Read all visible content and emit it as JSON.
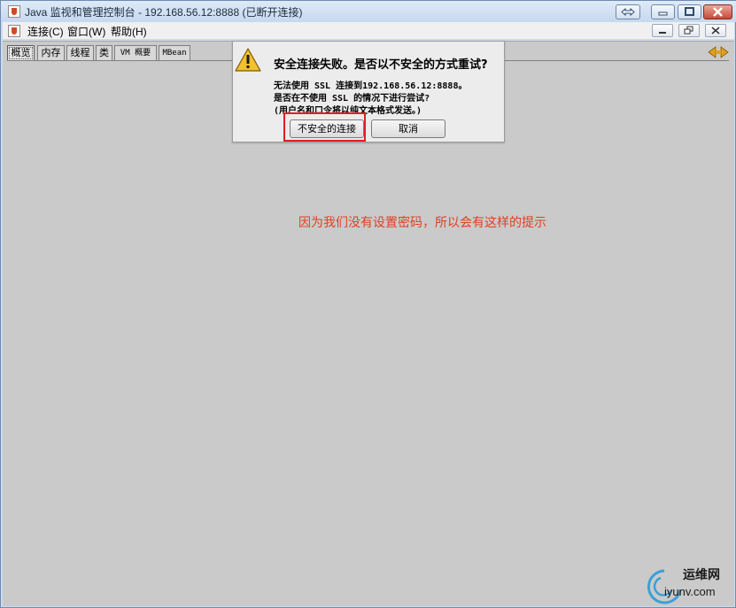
{
  "window": {
    "title": "Java 监视和管理控制台 - 192.168.56.12:8888 (已断开连接)"
  },
  "menubar": {
    "items": [
      "连接(C)",
      "窗口(W)",
      "帮助(H)"
    ]
  },
  "tabs": [
    "概览",
    "内存",
    "线程",
    "类",
    "VM 概要",
    "MBean"
  ],
  "dialog": {
    "title": "安全连接失败。是否以不安全的方式重试?",
    "lines": [
      "无法使用 SSL 连接到192.168.56.12:8888。",
      "是否在不使用 SSL 的情况下进行尝试?",
      "(用户名和口令将以纯文本格式发送。)"
    ],
    "insecure_button": "不安全的连接",
    "cancel_button": "取消"
  },
  "annotation": "因为我们没有设置密码，所以会有这样的提示",
  "watermark": {
    "site_cn": "运维网",
    "site_url": "iyunv.com"
  },
  "colors": {
    "client_bg": "#cacaca",
    "annotation": "#e04020",
    "highlight": "#e02020"
  }
}
